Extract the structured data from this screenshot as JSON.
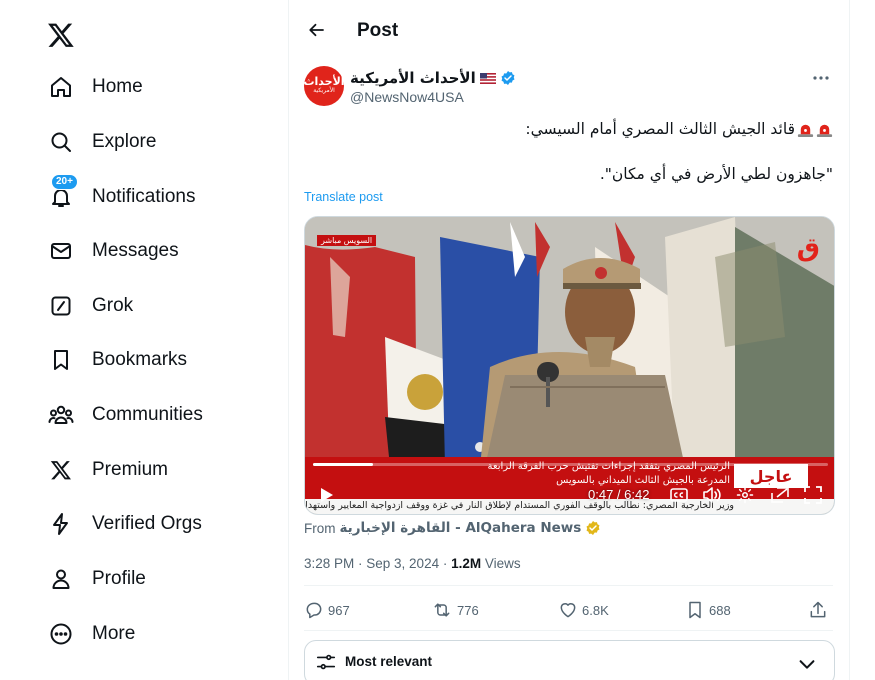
{
  "app": {
    "logo": "x-logo-icon"
  },
  "sidebar": {
    "items": [
      {
        "label": "Home",
        "icon": "home-icon"
      },
      {
        "label": "Explore",
        "icon": "search-icon"
      },
      {
        "label": "Notifications",
        "icon": "bell-icon",
        "badge": "20+"
      },
      {
        "label": "Messages",
        "icon": "envelope-icon"
      },
      {
        "label": "Grok",
        "icon": "grok-icon"
      },
      {
        "label": "Bookmarks",
        "icon": "bookmark-icon"
      },
      {
        "label": "Communities",
        "icon": "people-icon"
      },
      {
        "label": "Premium",
        "icon": "x-logo-icon"
      },
      {
        "label": "Verified Orgs",
        "icon": "lightning-icon"
      },
      {
        "label": "Profile",
        "icon": "person-icon"
      },
      {
        "label": "More",
        "icon": "more-circle-icon"
      }
    ]
  },
  "header": {
    "title": "Post"
  },
  "post": {
    "author_name": "الأحداث الأمريكية",
    "author_handle": "@NewsNow4USA",
    "avatar_text": "الأحداث",
    "avatar_sub": "الأمريكية",
    "line1": "قائد الجيش الثالث المصري أمام السيسي:",
    "line2": "\"جاهزون لطي الأرض في أي مكان\".",
    "translate": "Translate post",
    "video": {
      "live_tag": "السويس مباشر",
      "channel_logo": "ق",
      "breaking": "عاجل",
      "ticker_line1": "الرئيس المصري يتفقد إجراءات تفتيش حرب الفرقة الرابعة",
      "ticker_line2": "المدرعة بالجيش الثالث الميداني بالسويس",
      "ticker_bottom": "وزير الخارجية المصري: نطالب بالوقف الفوري المستدام لإطلاق النار في غزة ووقف ازدواجية المعايير واستهداف",
      "time": "0:47 / 6:42",
      "progress": 0.117
    },
    "from_label": "From",
    "from_source": "القاهرة الإخبارية - AlQahera News",
    "timestamp": "3:28 PM · Sep 3, 2024 · ",
    "views_count": "1.2M",
    "views_label": " Views",
    "stats": {
      "replies": "967",
      "reposts": "776",
      "likes": "6.8K",
      "bookmarks": "688"
    }
  },
  "replies_sort": {
    "label": "Most relevant"
  },
  "colors": {
    "accent": "#1d9bf0",
    "text": "#0f1419",
    "muted": "#536471",
    "verified_gold": "#e2b719",
    "breaking_red": "#c40f10"
  }
}
